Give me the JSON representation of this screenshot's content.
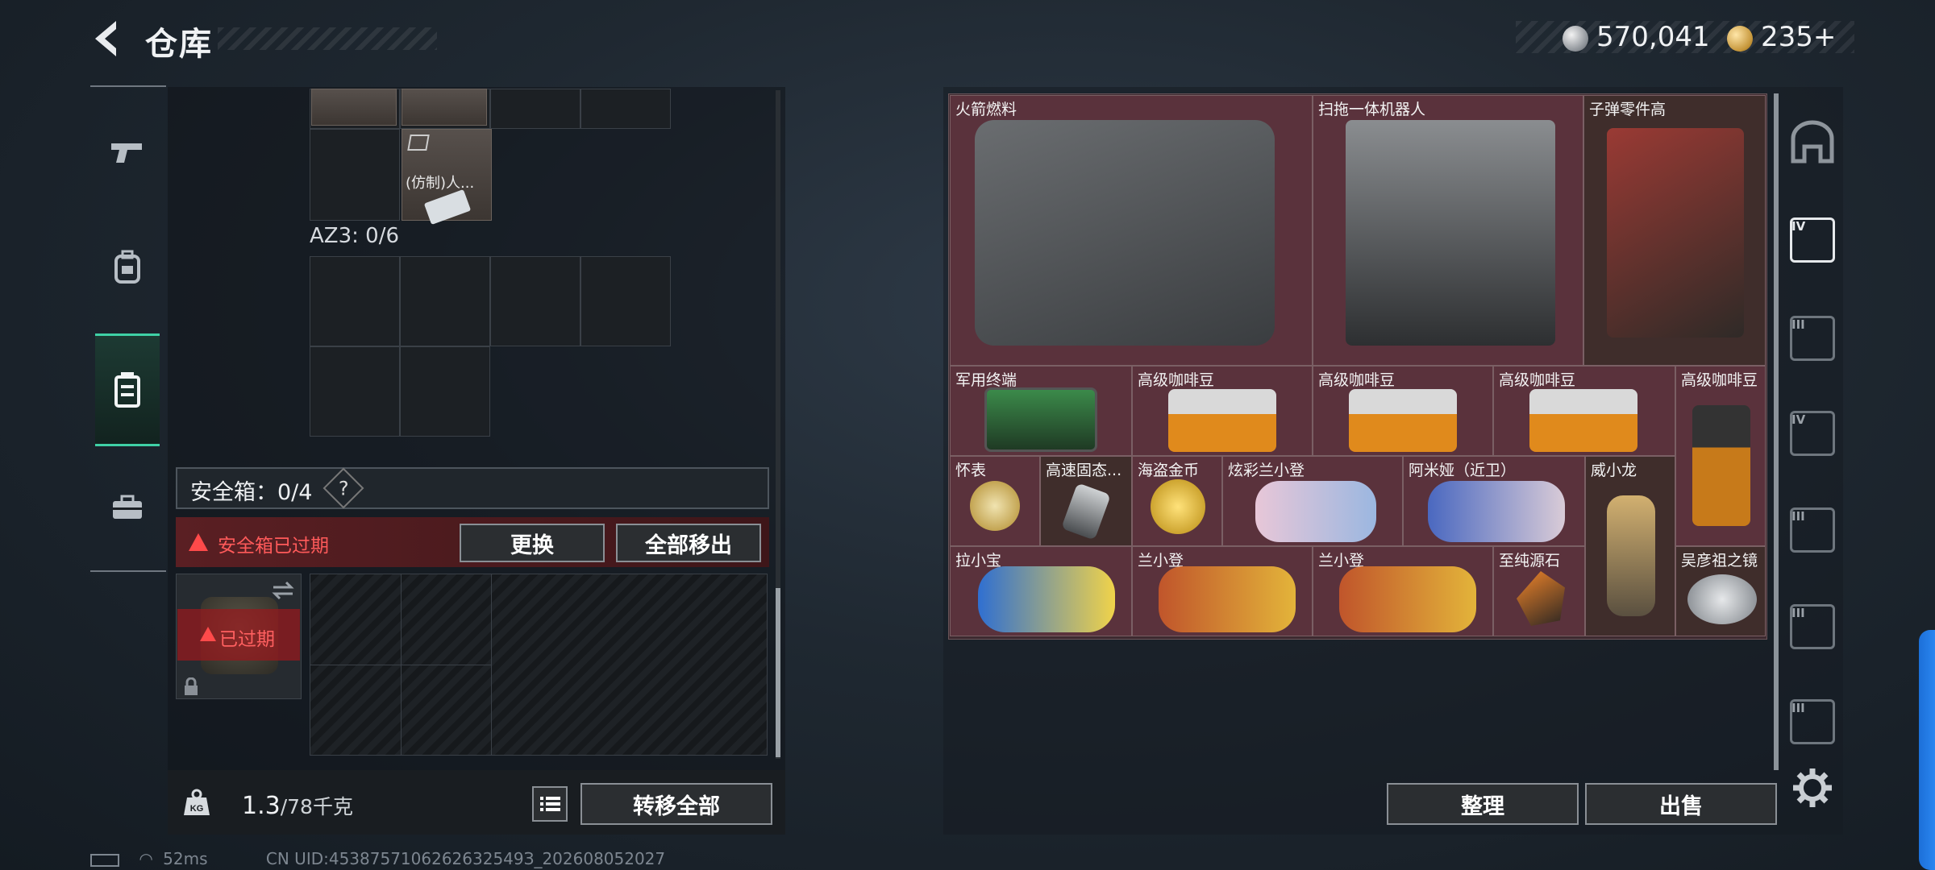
{
  "header": {
    "title": "仓库",
    "currency_silver": "570,041",
    "currency_gold": "235+"
  },
  "sidebar": {
    "items": [
      "weapon",
      "armor",
      "container",
      "toolbox"
    ],
    "active": "container"
  },
  "left": {
    "top_item_label": "(仿制)人...",
    "az3_label": "AZ3: 0/6",
    "safe_box_label": "安全箱：0/4",
    "help": "?",
    "expired_notice": "安全箱已过期",
    "replace_button": "更换",
    "remove_all_button": "全部移出",
    "case_expired": "已过期",
    "weight_current": "1.3",
    "weight_max": "/78千克",
    "transfer_all_button": "转移全部",
    "kg_icon": "KG"
  },
  "status_bar": {
    "ping": "52ms",
    "uid": "CN UID:4538757106262632549З_202608052027"
  },
  "items": [
    {
      "label": "火箭燃料"
    },
    {
      "label": "扫拖一体机器人"
    },
    {
      "label": "子弹零件高"
    },
    {
      "label": "军用终端"
    },
    {
      "label": "高级咖啡豆"
    },
    {
      "label": "高级咖啡豆"
    },
    {
      "label": "高级咖啡豆"
    },
    {
      "label": "高级咖啡豆"
    },
    {
      "label": "怀表"
    },
    {
      "label": "高速固态..."
    },
    {
      "label": "海盗金币"
    },
    {
      "label": "炫彩兰小登"
    },
    {
      "label": "阿米娅（近卫）"
    },
    {
      "label": "威小龙"
    },
    {
      "label": "拉小宝"
    },
    {
      "label": "兰小登"
    },
    {
      "label": "兰小登"
    },
    {
      "label": "至纯源石"
    },
    {
      "label": "吴彦祖之镜"
    }
  ],
  "right_buttons": {
    "sort": "整理",
    "sell": "出售"
  },
  "rail": {
    "roman": [
      "IV",
      "III",
      "IV",
      "III",
      "III",
      "III"
    ]
  }
}
